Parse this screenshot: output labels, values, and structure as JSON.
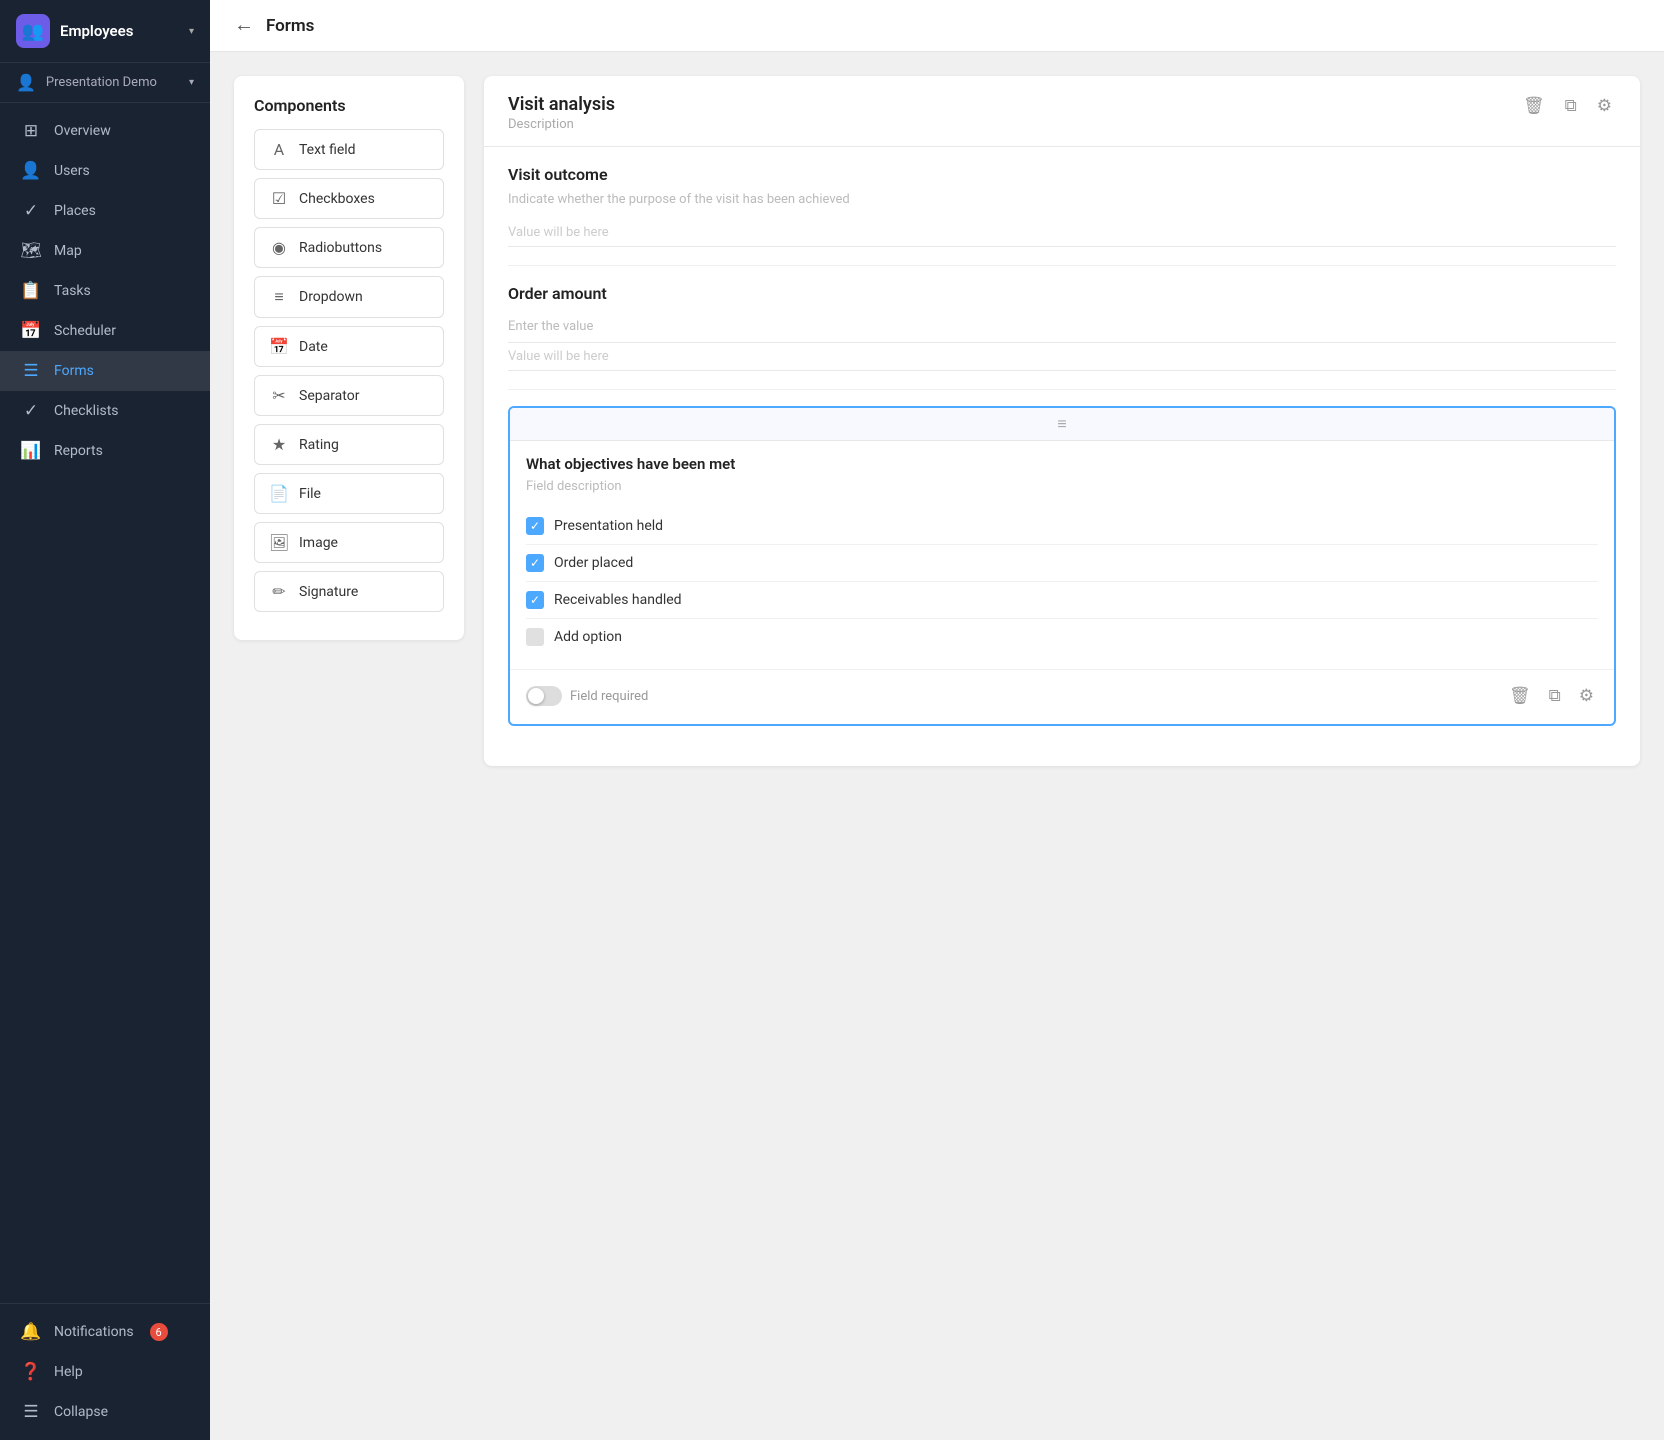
{
  "sidebar": {
    "brand": {
      "icon": "👥",
      "label": "Employees",
      "arrow": "▾"
    },
    "sub": {
      "icon": "👤",
      "label": "Presentation Demo",
      "arrow": "▾"
    },
    "nav_items": [
      {
        "id": "overview",
        "label": "Overview",
        "icon": "⊞"
      },
      {
        "id": "users",
        "label": "Users",
        "icon": "👤"
      },
      {
        "id": "places",
        "label": "Places",
        "icon": "✓"
      },
      {
        "id": "map",
        "label": "Map",
        "icon": "🗺"
      },
      {
        "id": "tasks",
        "label": "Tasks",
        "icon": "📋"
      },
      {
        "id": "scheduler",
        "label": "Scheduler",
        "icon": "📅"
      },
      {
        "id": "forms",
        "label": "Forms",
        "icon": "☰",
        "active": true
      },
      {
        "id": "checklists",
        "label": "Checklists",
        "icon": "✓"
      },
      {
        "id": "reports",
        "label": "Reports",
        "icon": "📊"
      }
    ],
    "footer_items": [
      {
        "id": "notifications",
        "label": "Notifications",
        "icon": "🔔",
        "badge": "6"
      },
      {
        "id": "help",
        "label": "Help",
        "icon": "❓"
      },
      {
        "id": "collapse",
        "label": "Collapse",
        "icon": "☰"
      }
    ]
  },
  "topbar": {
    "back_icon": "←",
    "title": "Forms"
  },
  "components_panel": {
    "title": "Components",
    "items": [
      {
        "id": "text-field",
        "label": "Text field",
        "icon": "A"
      },
      {
        "id": "checkboxes",
        "label": "Checkboxes",
        "icon": "☑"
      },
      {
        "id": "radiobuttons",
        "label": "Radiobuttons",
        "icon": "◉"
      },
      {
        "id": "dropdown",
        "label": "Dropdown",
        "icon": "≡"
      },
      {
        "id": "date",
        "label": "Date",
        "icon": "📅"
      },
      {
        "id": "separator",
        "label": "Separator",
        "icon": "✂"
      },
      {
        "id": "rating",
        "label": "Rating",
        "icon": "★"
      },
      {
        "id": "file",
        "label": "File",
        "icon": "📄"
      },
      {
        "id": "image",
        "label": "Image",
        "icon": "🖼"
      },
      {
        "id": "signature",
        "label": "Signature",
        "icon": "✏"
      }
    ]
  },
  "form_panel": {
    "title": "Visit analysis",
    "description": "Description",
    "sections": [
      {
        "id": "visit-outcome",
        "label": "Visit outcome",
        "hint": "Indicate whether the purpose of the visit has been achieved",
        "value_placeholder": "Value will be here"
      },
      {
        "id": "order-amount",
        "label": "Order amount",
        "input_placeholder": "Enter the value",
        "value_placeholder": "Value will be here"
      }
    ],
    "draggable_section": {
      "label": "What objectives have been met",
      "field_description": "Field description",
      "checkboxes": [
        {
          "id": "presentation-held",
          "label": "Presentation held",
          "checked": true
        },
        {
          "id": "order-placed",
          "label": "Order placed",
          "checked": true
        },
        {
          "id": "receivables-handled",
          "label": "Receivables handled",
          "checked": true
        },
        {
          "id": "add-option",
          "label": "Add option",
          "checked": false
        }
      ]
    },
    "field_required_label": "Field required",
    "icons": {
      "delete": "🗑",
      "copy": "⧉",
      "settings": "⚙"
    }
  }
}
